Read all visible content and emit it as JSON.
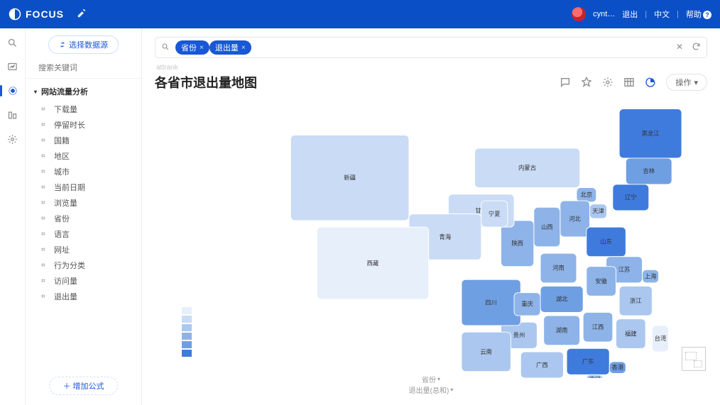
{
  "app_name": "FOCUS",
  "top": {
    "user": "cynt…",
    "logout": "退出",
    "lang": "中文",
    "help": "帮助",
    "help_badge": "?"
  },
  "datasource_button": "选择数据源",
  "search_placeholder": "搜索关键词",
  "tree_header": "网站流量分析",
  "fields": [
    "下载量",
    "停留时长",
    "国籍",
    "地区",
    "城市",
    "当前日期",
    "浏览量",
    "省份",
    "语言",
    "网址",
    "行为分类",
    "访问量",
    "退出量"
  ],
  "add_formula": "增加公式",
  "query_chips": [
    "省份",
    "退出量"
  ],
  "breadcrumb": "attrank",
  "page_title": "各省市退出量地图",
  "ops_label": "操作",
  "footer": {
    "dim": "省份",
    "measure": "退出量(总和)"
  },
  "legend_colors": [
    "#e7effb",
    "#c9dbf5",
    "#abc7ef",
    "#8db3e9",
    "#6f9fe3",
    "#3f7bdc"
  ],
  "chart_data": {
    "type": "heatmap",
    "title": "各省市退出量地图",
    "measure": "退出量(总和)",
    "legend_range": [
      0,
      100
    ],
    "provinces": [
      {
        "name": "黑龙江",
        "value": 90
      },
      {
        "name": "吉林",
        "value": 75
      },
      {
        "name": "辽宁",
        "value": 92
      },
      {
        "name": "北京",
        "value": 60
      },
      {
        "name": "天津",
        "value": 45
      },
      {
        "name": "河北",
        "value": 50
      },
      {
        "name": "内蒙古",
        "value": 30
      },
      {
        "name": "山西",
        "value": 55
      },
      {
        "name": "山东",
        "value": 95
      },
      {
        "name": "河南",
        "value": 60
      },
      {
        "name": "江苏",
        "value": 65
      },
      {
        "name": "上海",
        "value": 55
      },
      {
        "name": "安徽",
        "value": 55
      },
      {
        "name": "浙江",
        "value": 35
      },
      {
        "name": "湖北",
        "value": 75
      },
      {
        "name": "湖南",
        "value": 55
      },
      {
        "name": "江西",
        "value": 50
      },
      {
        "name": "福建",
        "value": 40
      },
      {
        "name": "台湾",
        "value": 10
      },
      {
        "name": "广东",
        "value": 95
      },
      {
        "name": "广西",
        "value": 45
      },
      {
        "name": "香港",
        "value": 70
      },
      {
        "name": "澳门",
        "value": 35
      },
      {
        "name": "贵州",
        "value": 40
      },
      {
        "name": "云南",
        "value": 35
      },
      {
        "name": "四川",
        "value": 70
      },
      {
        "name": "重庆",
        "value": 50
      },
      {
        "name": "陕西",
        "value": 60
      },
      {
        "name": "甘肃",
        "value": 30
      },
      {
        "name": "宁夏",
        "value": 25
      },
      {
        "name": "青海",
        "value": 20
      },
      {
        "name": "西藏",
        "value": 15
      },
      {
        "name": "新疆",
        "value": 18
      }
    ]
  }
}
